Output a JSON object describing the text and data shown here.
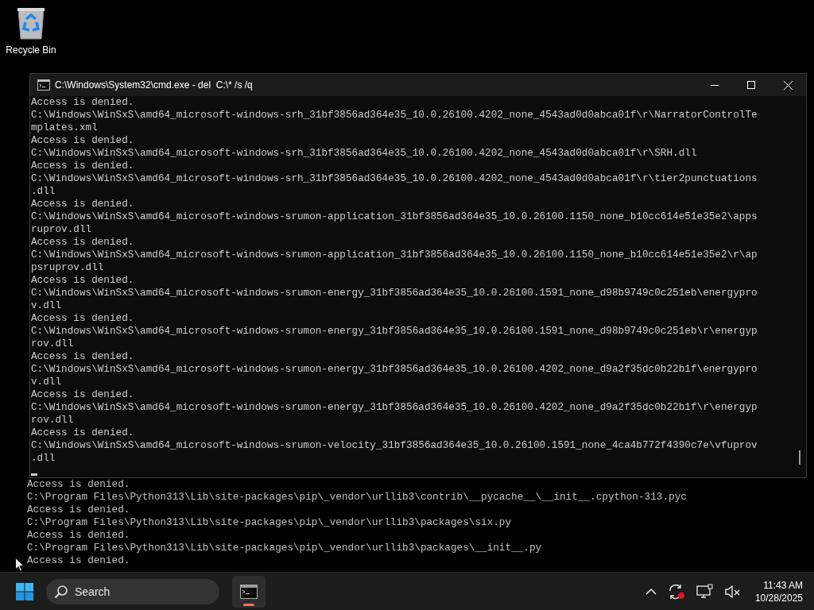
{
  "desktop_icons": [
    {
      "label": "Recycle Bin"
    }
  ],
  "console_window": {
    "title": "C:\\Windows\\System32\\cmd.exe - del  C:\\* /s /q",
    "lines": [
      "Access is denied.",
      "C:\\Windows\\WinSxS\\amd64_microsoft-windows-srh_31bf3856ad364e35_10.0.26100.4202_none_4543ad0d0abca01f\\r\\NarratorControlTe",
      "mplates.xml",
      "Access is denied.",
      "C:\\Windows\\WinSxS\\amd64_microsoft-windows-srh_31bf3856ad364e35_10.0.26100.4202_none_4543ad0d0abca01f\\r\\SRH.dll",
      "Access is denied.",
      "C:\\Windows\\WinSxS\\amd64_microsoft-windows-srh_31bf3856ad364e35_10.0.26100.4202_none_4543ad0d0abca01f\\r\\tier2punctuations",
      ".dll",
      "Access is denied.",
      "C:\\Windows\\WinSxS\\amd64_microsoft-windows-srumon-application_31bf3856ad364e35_10.0.26100.1150_none_b10cc614e51e35e2\\apps",
      "ruprov.dll",
      "Access is denied.",
      "C:\\Windows\\WinSxS\\amd64_microsoft-windows-srumon-application_31bf3856ad364e35_10.0.26100.1150_none_b10cc614e51e35e2\\r\\ap",
      "psruprov.dll",
      "Access is denied.",
      "C:\\Windows\\WinSxS\\amd64_microsoft-windows-srumon-energy_31bf3856ad364e35_10.0.26100.1591_none_d98b9749c0c251eb\\energypro",
      "v.dll",
      "Access is denied.",
      "C:\\Windows\\WinSxS\\amd64_microsoft-windows-srumon-energy_31bf3856ad364e35_10.0.26100.1591_none_d98b9749c0c251eb\\r\\energyp",
      "rov.dll",
      "Access is denied.",
      "C:\\Windows\\WinSxS\\amd64_microsoft-windows-srumon-energy_31bf3856ad364e35_10.0.26100.4202_none_d9a2f35dc0b22b1f\\energypro",
      "v.dll",
      "Access is denied.",
      "C:\\Windows\\WinSxS\\amd64_microsoft-windows-srumon-energy_31bf3856ad364e35_10.0.26100.4202_none_d9a2f35dc0b22b1f\\r\\energyp",
      "rov.dll",
      "Access is denied.",
      "C:\\Windows\\WinSxS\\amd64_microsoft-windows-srumon-velocity_31bf3856ad364e35_10.0.26100.1591_none_4ca4b772f4390c7e\\vfuprov",
      ".dll"
    ]
  },
  "background_console": {
    "lines": [
      "Access is denied.",
      "C:\\Program Files\\Python313\\Lib\\site-packages\\pip\\_vendor\\urllib3\\contrib\\__pycache__\\__init__.cpython-313.pyc",
      "Access is denied.",
      "C:\\Program Files\\Python313\\Lib\\site-packages\\pip\\_vendor\\urllib3\\packages\\six.py",
      "Access is denied.",
      "C:\\Program Files\\Python313\\Lib\\site-packages\\pip\\_vendor\\urllib3\\packages\\__init__.py",
      "Access is denied."
    ]
  },
  "taskbar": {
    "search": {
      "placeholder": "Search"
    },
    "clock": {
      "time": "11:43 AM",
      "date": "10/28/2025"
    }
  }
}
